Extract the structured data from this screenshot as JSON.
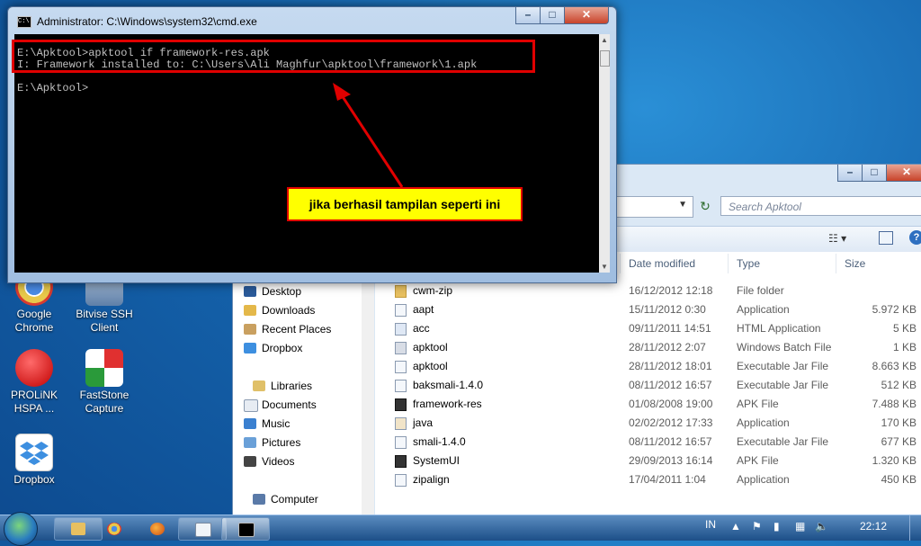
{
  "desktop": {
    "icons": [
      {
        "label": "Google Chrome",
        "color": "#e8c84a"
      },
      {
        "label": "Bitvise SSH Client",
        "color": "#7aa0c8"
      },
      {
        "label": "PROLiNK HSPA ...",
        "color": "#e02020"
      },
      {
        "label": "FastStone Capture",
        "color": "#e03030"
      },
      {
        "label": "Dropbox",
        "color": "#3d8fe0"
      }
    ]
  },
  "cmd": {
    "title": "Administrator: C:\\Windows\\system32\\cmd.exe",
    "lines": [
      "E:\\Apktool>apktool if framework-res.apk",
      "I: Framework installed to: C:\\Users\\Ali Maghfur\\apktool\\framework\\1.apk",
      "",
      "E:\\Apktool>"
    ]
  },
  "annotation": {
    "callout_text": "jika berhasil tampilan seperti ini",
    "color": "#e00000"
  },
  "explorer": {
    "search_placeholder": "Search Apktool",
    "nav": [
      {
        "label": "Desktop"
      },
      {
        "label": "Downloads"
      },
      {
        "label": "Recent Places"
      },
      {
        "label": "Dropbox"
      },
      {
        "label": "Libraries"
      },
      {
        "label": "Documents"
      },
      {
        "label": "Music"
      },
      {
        "label": "Pictures"
      },
      {
        "label": "Videos"
      },
      {
        "label": "Computer"
      }
    ],
    "columns": {
      "date": "Date modified",
      "type": "Type",
      "size": "Size"
    },
    "files": [
      {
        "name": "cwm-zip",
        "date": "16/12/2012 12:18",
        "type": "File folder",
        "size": ""
      },
      {
        "name": "aapt",
        "date": "15/11/2012 0:30",
        "type": "Application",
        "size": "5.972 KB"
      },
      {
        "name": "acc",
        "date": "09/11/2011 14:51",
        "type": "HTML Application",
        "size": "5 KB"
      },
      {
        "name": "apktool",
        "date": "28/11/2012 2:07",
        "type": "Windows Batch File",
        "size": "1 KB"
      },
      {
        "name": "apktool",
        "date": "28/11/2012 18:01",
        "type": "Executable Jar File",
        "size": "8.663 KB"
      },
      {
        "name": "baksmali-1.4.0",
        "date": "08/11/2012 16:57",
        "type": "Executable Jar File",
        "size": "512 KB"
      },
      {
        "name": "framework-res",
        "date": "01/08/2008 19:00",
        "type": "APK File",
        "size": "7.488 KB"
      },
      {
        "name": "java",
        "date": "02/02/2012 17:33",
        "type": "Application",
        "size": "170 KB"
      },
      {
        "name": "smali-1.4.0",
        "date": "08/11/2012 16:57",
        "type": "Executable Jar File",
        "size": "677 KB"
      },
      {
        "name": "SystemUI",
        "date": "29/09/2013 16:14",
        "type": "APK File",
        "size": "1.320 KB"
      },
      {
        "name": "zipalign",
        "date": "17/04/2011 1:04",
        "type": "Application",
        "size": "450 KB"
      }
    ]
  },
  "taskbar": {
    "language": "IN",
    "clock": "22:12"
  }
}
